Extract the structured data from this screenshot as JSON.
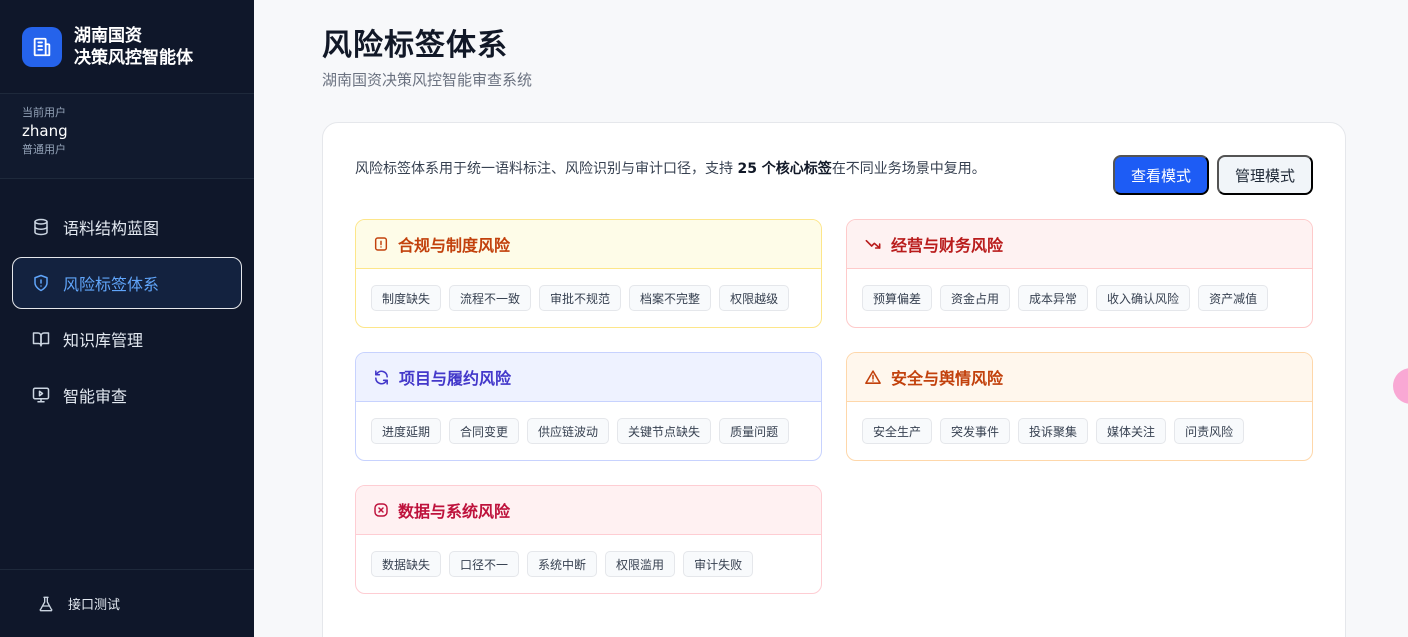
{
  "brand": {
    "line1": "湖南国资",
    "line2": "决策风控智能体",
    "logo_icon": "building-icon"
  },
  "user": {
    "label": "当前用户",
    "name": "zhang",
    "role": "普通用户"
  },
  "nav": [
    {
      "label": "语料结构蓝图",
      "icon": "database-icon",
      "active": false
    },
    {
      "label": "风险标签体系",
      "icon": "shield-alert-icon",
      "active": true
    },
    {
      "label": "知识库管理",
      "icon": "book-icon",
      "active": false
    },
    {
      "label": "智能审查",
      "icon": "monitor-play-icon",
      "active": false
    }
  ],
  "footer": {
    "label": "接口测试",
    "icon": "flask-icon"
  },
  "page": {
    "title": "风险标签体系",
    "subtitle": "湖南国资决策风控智能审查系统"
  },
  "intro": {
    "prefix": "风险标签体系用于统一语料标注、风险识别与审计口径，支持 ",
    "count": "25 个核心标签",
    "suffix": "在不同业务场景中复用。"
  },
  "modes": {
    "view_label": "查看模式",
    "manage_label": "管理模式"
  },
  "categories": [
    {
      "title": "合规与制度风险",
      "icon": "alert-square-icon",
      "tags": [
        "制度缺失",
        "流程不一致",
        "审批不规范",
        "档案不完整",
        "权限越级"
      ]
    },
    {
      "title": "经营与财务风险",
      "icon": "trending-down-icon",
      "tags": [
        "预算偏差",
        "资金占用",
        "成本异常",
        "收入确认风险",
        "资产减值"
      ]
    },
    {
      "title": "项目与履约风险",
      "icon": "refresh-icon",
      "tags": [
        "进度延期",
        "合同变更",
        "供应链波动",
        "关键节点缺失",
        "质量问题"
      ]
    },
    {
      "title": "安全与舆情风险",
      "icon": "warning-triangle-icon",
      "tags": [
        "安全生产",
        "突发事件",
        "投诉聚集",
        "媒体关注",
        "问责风险"
      ]
    },
    {
      "title": "数据与系统风险",
      "icon": "x-square-icon",
      "tags": [
        "数据缺失",
        "口径不一",
        "系统中断",
        "权限滥用",
        "审计失败"
      ]
    }
  ],
  "colors": {
    "primary": "#1d5cf5",
    "sidebar_bg": "#0f172a",
    "active_text": "#60a5fa"
  }
}
